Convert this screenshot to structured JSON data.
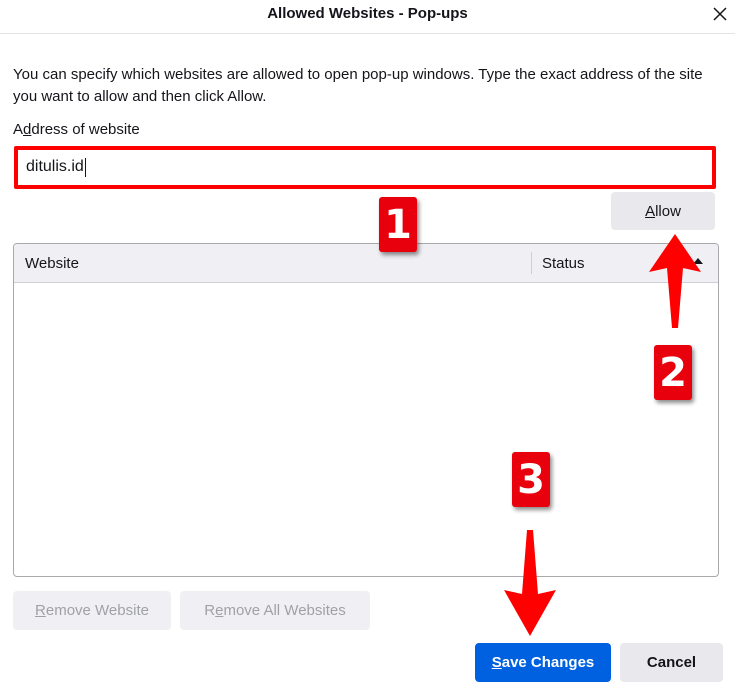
{
  "dialog": {
    "title": "Allowed Websites - Pop-ups",
    "description": "You can specify which websites are allowed to open pop-up windows. Type the exact address of the site you want to allow and then click Allow."
  },
  "address": {
    "label_pre": "A",
    "label_key": "d",
    "label_post": "dress of website",
    "value": "ditulis.id"
  },
  "allow_button": {
    "key": "A",
    "rest": "llow"
  },
  "table": {
    "columns": [
      "Website",
      "Status"
    ],
    "rows": []
  },
  "remove_website_button": {
    "key": "R",
    "rest": "emove Website"
  },
  "remove_all_button": {
    "pre": "R",
    "key": "e",
    "rest": "move All Websites"
  },
  "save_button": {
    "key": "S",
    "rest": "ave Changes"
  },
  "cancel_button": {
    "label": "Cancel"
  },
  "annotations": [
    "1",
    "2",
    "3"
  ],
  "colors": {
    "accent": "#0061e0",
    "highlight": "#ff0000",
    "badge": "#e8000c"
  }
}
